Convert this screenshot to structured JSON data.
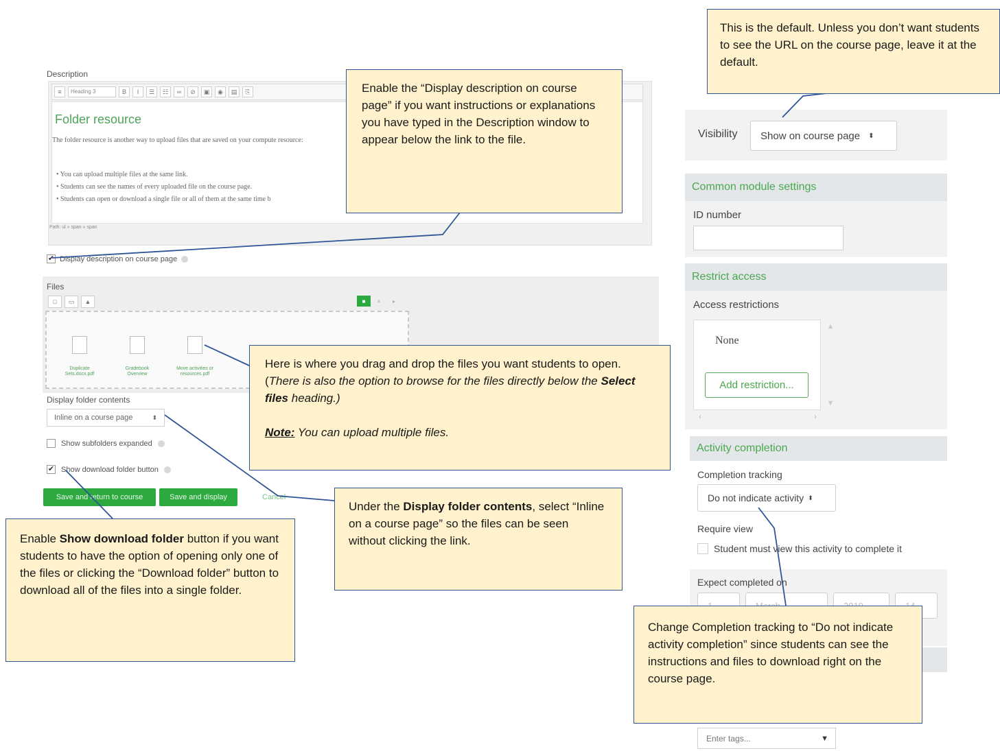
{
  "form": {
    "description_label": "Description",
    "editor_heading": "Folder resource",
    "editor_intro": "The folder resource is another way to upload files that are saved on your compute resource:",
    "editor_bullets": [
      "You can upload multiple files at the same link.",
      "Students can see the names of every uploaded file on the course page.",
      "Students can open or download a single file or all of them at the same time b"
    ],
    "editor_format_select": "Heading 3",
    "editor_path": "Path: ul » span » span",
    "display_description_label": "Display description on course page",
    "display_description_checked": true,
    "files_label": "Files",
    "files": [
      "Duplicate Sets.docx.pdf",
      "Gradebook Overview",
      "Move activities or resources.pdf"
    ],
    "display_folder_contents_label": "Display folder contents",
    "display_folder_contents_value": "Inline on a course page",
    "show_subfolders_label": "Show subfolders expanded",
    "show_subfolders_checked": false,
    "show_download_label": "Show download folder button",
    "show_download_checked": true,
    "save_return_label": "Save and return to course",
    "save_display_label": "Save and display",
    "cancel_label": "Cancel"
  },
  "settings": {
    "visibility_label": "Visibility",
    "visibility_value": "Show on course page",
    "common_module_heading": "Common module settings",
    "id_number_label": "ID number",
    "restrict_access_heading": "Restrict access",
    "access_restrictions_label": "Access restrictions",
    "access_restrictions_value": "None",
    "add_restriction_label": "Add restriction...",
    "activity_completion_heading": "Activity completion",
    "completion_tracking_label": "Completion tracking",
    "completion_tracking_value": "Do not indicate activity",
    "require_view_label": "Require view",
    "require_view_checkbox_label": "Student must view this activity to complete it",
    "expect_completed_label": "Expect completed on",
    "expect_completed_day": "1",
    "expect_completed_month": "March",
    "expect_completed_year": "2019",
    "expect_completed_hour": "14",
    "tags_placeholder": "Enter tags..."
  },
  "callouts": {
    "visibility": "This is the default. Unless you don’t want students to see the URL on the course page, leave it at the default.",
    "display_description": "Enable the “Display description on course page” if you want instructions or explanations you have typed in the Description window to appear below the link to the file.",
    "files_1": "Here is where you drag and drop the files you want students to open. (",
    "files_2": "There is also the option to browse for the files directly below the ",
    "files_3": "Select files",
    "files_4": " heading.)",
    "files_note_label": "Note:",
    "files_note": " You can upload multiple files.",
    "display_folder_1": "Under the ",
    "display_folder_2": "Display folder contents",
    "display_folder_3": ", select “Inline on a course page” so the files can be seen without clicking the link.",
    "show_download_1": "Enable ",
    "show_download_2": "Show download folder",
    "show_download_3": " button if you want students to have the option of opening only one of the files or clicking the “Download folder” button to download all of the files into a single folder.",
    "completion": "Change Completion tracking to “Do not indicate activity completion” since students can see the instructions and files to download right on the course page."
  },
  "colors": {
    "callout_fill": "#fff2cc",
    "callout_border": "#2f5597",
    "moodle_green": "#49a84f"
  }
}
